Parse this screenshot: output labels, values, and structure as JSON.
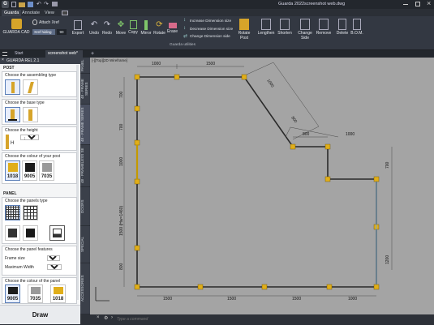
{
  "app": {
    "title": "Guarda 2022",
    "file": "screenshot web.dwg",
    "logo": "G"
  },
  "quick_icons": [
    "new-icon",
    "open-icon",
    "save-icon",
    "undo-icon",
    "redo-icon",
    "print-icon"
  ],
  "ribbon_tabs": [
    "Guarda",
    "Annotate",
    "View"
  ],
  "ribbon": {
    "guarda_cad": "GUARDA CAD",
    "attach_xref": "Attach Xref",
    "xref_hiding": "Xref hiding",
    "xref_value": "90",
    "export": "Export",
    "undo": "Undo",
    "redo": "Redo",
    "move": "Move",
    "copy": "Copy",
    "mirror": "Mirror",
    "rotate": "Rotate",
    "erase": "Erase",
    "inc_dim": "Increase Dimension size",
    "dec_dim": "Decrease Dimension size",
    "change_dim": "Change Dimension side",
    "rotate_post": "Rotate Post",
    "lengthen": "Lengthen",
    "shorten": "Shorten",
    "change_side": "Change Side",
    "remove": "Remove",
    "delete": "Delete",
    "bom": "B.O.M.",
    "group_label": "Guarda utilities"
  },
  "doc_tabs": [
    "Start",
    "screenshot web*"
  ],
  "viewport_label": "[-][Top][2D Wireframe]",
  "panel": {
    "title": "GUARDA REL 2.1",
    "post_header": "POST",
    "assembling_label": "Choose the assembling type",
    "base_label": "Choose the base type",
    "height_label": "Choose the height",
    "height_value": "2520",
    "height_options": [
      "2520"
    ],
    "height_letter": "H",
    "post_colour_label": "Choose the colour of your post",
    "post_colours": [
      {
        "code": "1018",
        "color": "#e0ae1a"
      },
      {
        "code": "9005",
        "color": "#1c1c1c"
      },
      {
        "code": "7035",
        "color": "#9a9a9a"
      }
    ],
    "panel_header": "PANEL",
    "panels_type_label": "Choose the panels type",
    "features_label": "Choose the panel features",
    "frame_size_label": "Frame size",
    "frame_size_value": "T20",
    "frame_size_options": [
      "T20"
    ],
    "max_width_label": "Maximum Width",
    "max_width_value": "1500",
    "max_width_options": [
      "1500"
    ],
    "panel_colour_label": "Choose the colour of the panel",
    "panel_colours": [
      {
        "code": "9005",
        "color": "#1c1c1c"
      },
      {
        "code": "7035",
        "color": "#9a9a9a"
      },
      {
        "code": "1018",
        "color": "#e0ae1a"
      }
    ],
    "draw_button": "Draw"
  },
  "vertical_tabs": [
    "PANEL",
    "48 - FRAME SERIES",
    "48 - FRAME SERIES",
    "48 - FRAMELESS SE",
    "DOORS",
    "SPECIAL",
    "ACCESSORIES"
  ],
  "command": {
    "placeholder": "Type a command"
  },
  "dimensions": {
    "top_left": "1000",
    "top_mid": "1500",
    "diag_long": "1000",
    "diag_short": "800",
    "step_800": "800",
    "right_top": "1000",
    "left_700a": "700",
    "left_700b": "700",
    "left_1000": "1000",
    "left_1500": "1500 (Hw=1460)",
    "left_800": "800",
    "right_700": "700",
    "right_1200": "1200",
    "bottom": [
      "1500",
      "1500",
      "1500",
      "1000"
    ]
  }
}
